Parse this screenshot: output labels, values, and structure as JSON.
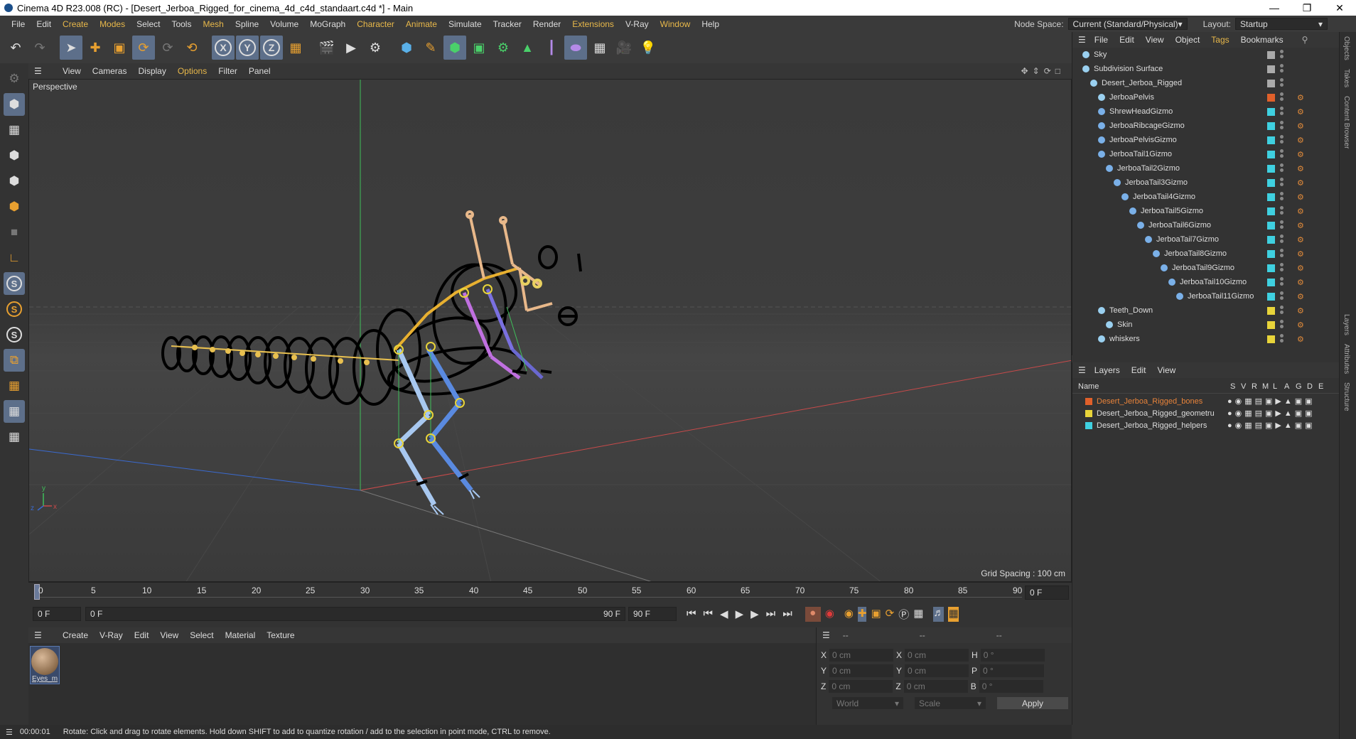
{
  "window": {
    "title": "Cinema 4D R23.008 (RC) - [Desert_Jerboa_Rigged_for_cinema_4d_c4d_standaart.c4d *] - Main"
  },
  "menubar": {
    "items": [
      "File",
      "Edit",
      "Create",
      "Modes",
      "Select",
      "Tools",
      "Mesh",
      "Spline",
      "Volume",
      "MoGraph",
      "Character",
      "Animate",
      "Simulate",
      "Tracker",
      "Render",
      "Extensions",
      "V-Ray",
      "Window",
      "Help"
    ],
    "node_space_label": "Node Space:",
    "node_space_value": "Current (Standard/Physical)",
    "layout_label": "Layout:",
    "layout_value": "Startup"
  },
  "viewport": {
    "menu": [
      "View",
      "Cameras",
      "Display",
      "Options",
      "Filter",
      "Panel"
    ],
    "label": "Perspective",
    "grid_spacing": "Grid Spacing : 100 cm"
  },
  "timeline": {
    "ticks": [
      "0",
      "5",
      "10",
      "15",
      "20",
      "25",
      "30",
      "35",
      "40",
      "45",
      "50",
      "55",
      "60",
      "65",
      "70",
      "75",
      "80",
      "85",
      "90"
    ],
    "current_frame": "0 F",
    "start_field": "0 F",
    "range_start": "0 F",
    "range_end": "90 F",
    "end_field": "90 F"
  },
  "material_manager": {
    "menu": [
      "Create",
      "V-Ray",
      "Edit",
      "View",
      "Select",
      "Material",
      "Texture"
    ],
    "materials": [
      {
        "name": "Eyes_m"
      }
    ]
  },
  "coordinates": {
    "header": [
      "--",
      "--",
      "--"
    ],
    "rows": [
      {
        "a": "X",
        "av": "0 cm",
        "b": "X",
        "bv": "0 cm",
        "c": "H",
        "cv": "0 °"
      },
      {
        "a": "Y",
        "av": "0 cm",
        "b": "Y",
        "bv": "0 cm",
        "c": "P",
        "cv": "0 °"
      },
      {
        "a": "Z",
        "av": "0 cm",
        "b": "Z",
        "bv": "0 cm",
        "c": "B",
        "cv": "0 °"
      }
    ],
    "space": "World",
    "mode": "Scale",
    "apply": "Apply"
  },
  "status": {
    "time": "00:00:01",
    "message": "Rotate: Click and drag to rotate elements. Hold down SHIFT to add to quantize rotation / add to the selection in point mode, CTRL to remove."
  },
  "object_manager": {
    "menu": [
      "File",
      "Edit",
      "View",
      "Object",
      "Tags",
      "Bookmarks"
    ],
    "objects": [
      {
        "name": "Sky",
        "level": 0,
        "tag": "#aaaaaa"
      },
      {
        "name": "Subdivision Surface",
        "level": 0,
        "tag": "#aaaaaa"
      },
      {
        "name": "Desert_Jerboa_Rigged",
        "level": 1,
        "tag": "#aaaaaa"
      },
      {
        "name": "JerboaPelvis",
        "level": 2,
        "tag": "#e0602a"
      },
      {
        "name": "ShrewHeadGizmo",
        "level": 2,
        "tag": "#3fd0e0"
      },
      {
        "name": "JerboaRibcageGizmo",
        "level": 2,
        "tag": "#3fd0e0"
      },
      {
        "name": "JerboaPelvisGizmo",
        "level": 2,
        "tag": "#3fd0e0"
      },
      {
        "name": "JerboaTail1Gizmo",
        "level": 2,
        "tag": "#3fd0e0"
      },
      {
        "name": "JerboaTail2Gizmo",
        "level": 3,
        "tag": "#3fd0e0"
      },
      {
        "name": "JerboaTail3Gizmo",
        "level": 4,
        "tag": "#3fd0e0"
      },
      {
        "name": "JerboaTail4Gizmo",
        "level": 5,
        "tag": "#3fd0e0"
      },
      {
        "name": "JerboaTail5Gizmo",
        "level": 6,
        "tag": "#3fd0e0"
      },
      {
        "name": "JerboaTail6Gizmo",
        "level": 7,
        "tag": "#3fd0e0"
      },
      {
        "name": "JerboaTail7Gizmo",
        "level": 8,
        "tag": "#3fd0e0"
      },
      {
        "name": "JerboaTail8Gizmo",
        "level": 9,
        "tag": "#3fd0e0"
      },
      {
        "name": "JerboaTail9Gizmo",
        "level": 10,
        "tag": "#3fd0e0"
      },
      {
        "name": "JerboaTail10Gizmo",
        "level": 11,
        "tag": "#3fd0e0"
      },
      {
        "name": "JerboaTail11Gizmo",
        "level": 12,
        "tag": "#3fd0e0"
      },
      {
        "name": "Teeth_Down",
        "level": 2,
        "tag": "#e8d43a"
      },
      {
        "name": "Skin",
        "level": 3,
        "tag": "#e8d43a"
      },
      {
        "name": "whiskers",
        "level": 2,
        "tag": "#e8d43a"
      }
    ]
  },
  "layer_manager": {
    "menu": [
      "Layers",
      "Edit",
      "View"
    ],
    "columns": [
      "Name",
      "S",
      "V",
      "R",
      "M",
      "L",
      "A",
      "G",
      "D",
      "E"
    ],
    "layers": [
      {
        "name": "Desert_Jerboa_Rigged_bones",
        "color": "#e0602a",
        "highlight": true
      },
      {
        "name": "Desert_Jerboa_Rigged_geometru",
        "color": "#e8d43a",
        "highlight": false
      },
      {
        "name": "Desert_Jerboa_Rigged_helpers",
        "color": "#3fd0e0",
        "highlight": false
      }
    ]
  },
  "side_tabs": [
    "Objects",
    "Takes",
    "Content Browser",
    "Layers",
    "Attributes",
    "Structure"
  ]
}
